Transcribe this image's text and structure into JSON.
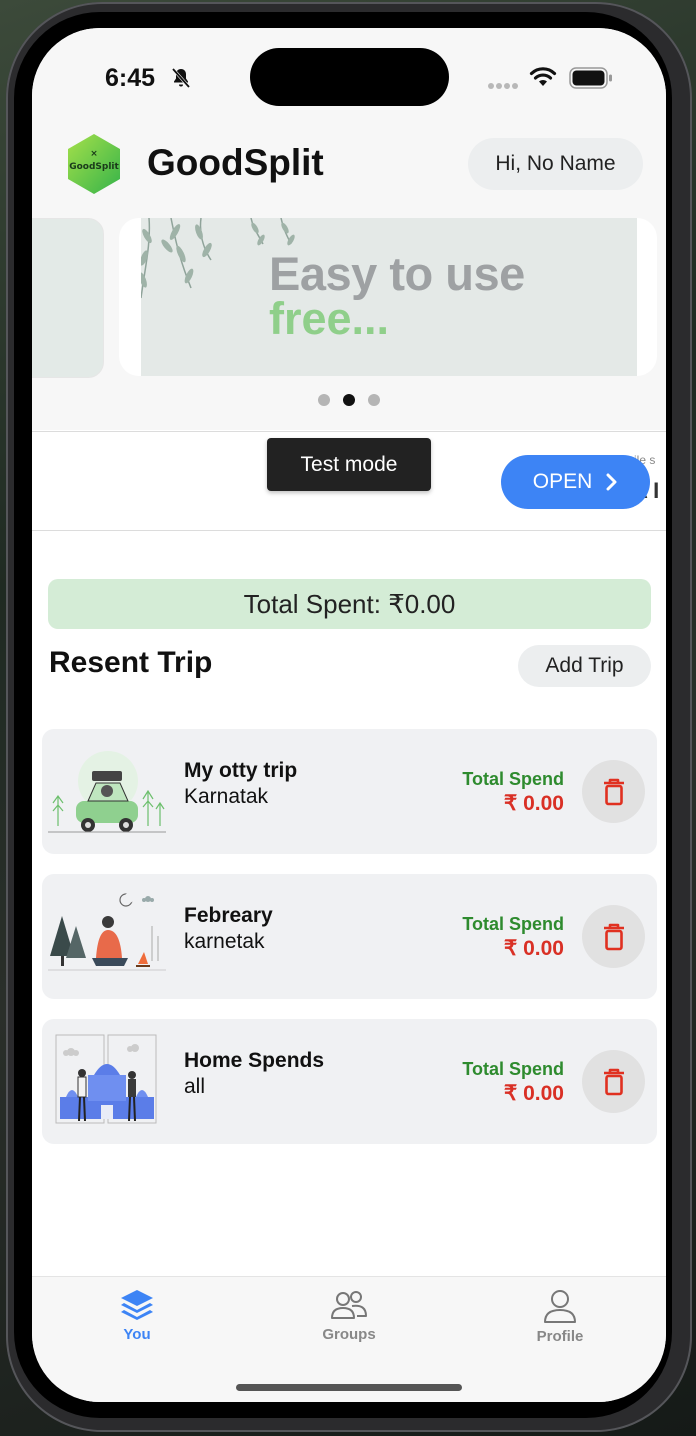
{
  "status": {
    "time": "6:45"
  },
  "app": {
    "title": "GoodSplit",
    "logo_text": "GoodSplit",
    "greeting": "Hi, No Name"
  },
  "banner": {
    "line1": "Easy to use",
    "line2": "free...",
    "dots": 3,
    "active_dot": 1
  },
  "ad": {
    "toast": "Test mode",
    "open_label": "OPEN"
  },
  "summary": {
    "total_spent": "Total Spent: ₹0.00"
  },
  "trips_section": {
    "title": "Resent Trip",
    "add_label": "Add Trip"
  },
  "trips": [
    {
      "name": "My otty trip",
      "place": "Karnatak",
      "spend_label": "Total Spend",
      "spend_value": "₹ 0.00",
      "illustration": "car-trip"
    },
    {
      "name": "Febreary",
      "place": "karnetak",
      "spend_label": "Total Spend",
      "spend_value": "₹ 0.00",
      "illustration": "campfire"
    },
    {
      "name": "Home Spends",
      "place": "all",
      "spend_label": "Total Spend",
      "spend_value": "₹ 0.00",
      "illustration": "palace"
    }
  ],
  "tabs": [
    {
      "label": "You",
      "icon": "stack-icon",
      "active": true
    },
    {
      "label": "Groups",
      "icon": "groups-icon",
      "active": false
    },
    {
      "label": "Profile",
      "icon": "person-icon",
      "active": false
    }
  ],
  "colors": {
    "accent": "#3d84f5",
    "green": "#2e8b2e",
    "red": "#d93025",
    "summary_bg": "#d4ecd6"
  }
}
